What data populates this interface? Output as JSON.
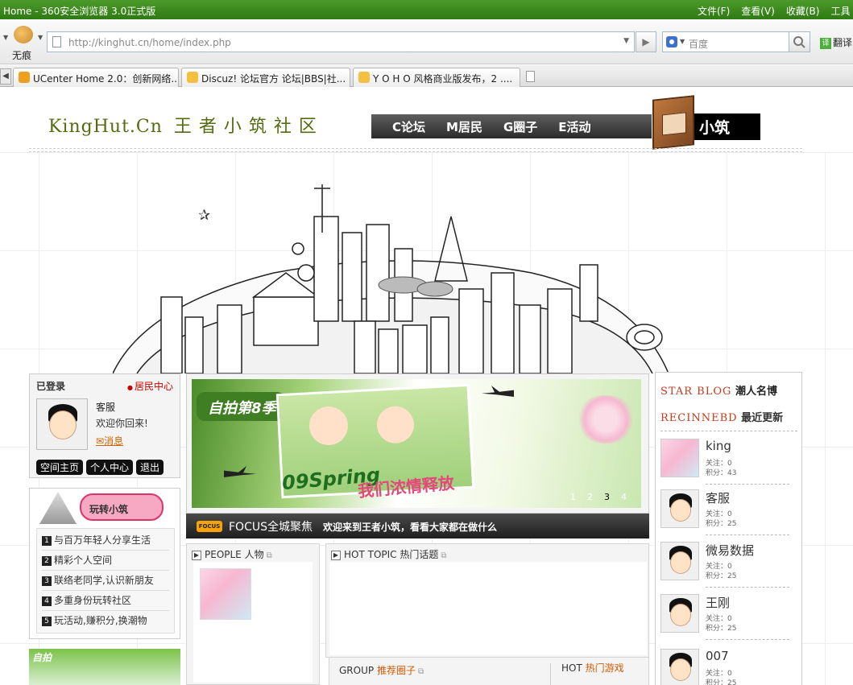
{
  "window": {
    "title": "Home - 360安全浏览器 3.0正式版",
    "menu": [
      "文件(F)",
      "查看(V)",
      "收藏(B)",
      "工具"
    ]
  },
  "toolbar": {
    "incognito_label": "无痕",
    "url": "http://kinghut.cn/home/index.php",
    "search_placeholder": "百度",
    "translate_label": "翻译"
  },
  "tabs": [
    {
      "label": "UCenter Home 2.0：创新网络...",
      "color": "#f0a020"
    },
    {
      "label": "Discuz! 论坛官方 论坛|BBS|社...",
      "color": "#f5c040"
    },
    {
      "label": "Y O H O 风格商业版发布，2 ....",
      "color": "#f5c040"
    }
  ],
  "site": {
    "logo_en": "KingHut.Cn",
    "logo_cn": "王者小筑社区",
    "nav": [
      "C论坛",
      "M居民",
      "G圈子",
      "E活动"
    ],
    "brand_badge": "小筑"
  },
  "login": {
    "title": "已登录",
    "center_link": "居民中心",
    "username": "客服",
    "welcome": "欢迎你回来!",
    "message_link": "消息",
    "buttons": [
      "空间主页",
      "个人中心",
      "退出"
    ]
  },
  "intro": {
    "banner_text": "玩转小筑",
    "items": [
      "与百万年轻人分享生活",
      "精彩个人空间",
      "联络老同学,认识新朋友",
      "多重身份玩转社区",
      "玩活动,赚积分,换潮物"
    ],
    "bottom_banner_text": "自拍"
  },
  "focus": {
    "banner_title": "自拍第8季",
    "banner_slogan": "09Spring",
    "banner_slogan_cn": "我们浓情释放",
    "pages": [
      "1",
      "2",
      "3",
      "4"
    ],
    "current_page": "3",
    "bar_tag": "FOCUS",
    "bar_title": "FOCUS全城聚焦",
    "bar_text": "欢迎来到王者小筑，看看大家都在做什么"
  },
  "panels": {
    "people_title": "PEOPLE 人物",
    "hot_topic_title": "HOT TOPIC 热门话题",
    "group_label": "GROUP",
    "group_title": "推荐圈子",
    "hot_label": "HOT",
    "hot_title": "热门游戏"
  },
  "sidebar": {
    "star_blog_en": "STAR BLOG",
    "star_blog_cn": "潮人名博",
    "recent_en": "RECINNEBD",
    "recent_cn": "最近更新",
    "users": [
      {
        "name": "king",
        "follow": "关注：0",
        "points": "积分：43",
        "avatar": "photo"
      },
      {
        "name": "客服",
        "follow": "关注：0",
        "points": "积分：25",
        "avatar": "cartoon"
      },
      {
        "name": "微易数据",
        "follow": "关注：0",
        "points": "积分：25",
        "avatar": "cartoon"
      },
      {
        "name": "王刚",
        "follow": "关注：0",
        "points": "积分：25",
        "avatar": "cartoon"
      },
      {
        "name": "007",
        "follow": "关注：0",
        "points": "积分：25",
        "avatar": "cartoon"
      }
    ]
  }
}
